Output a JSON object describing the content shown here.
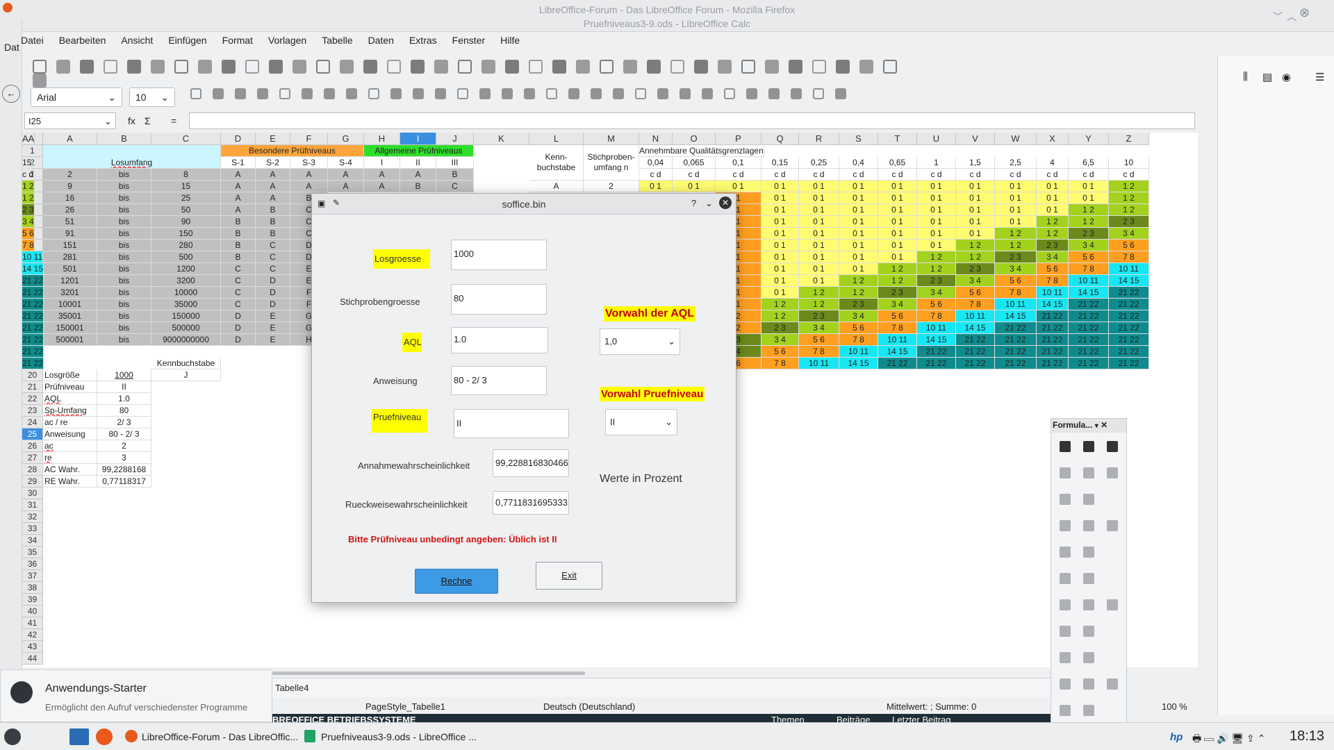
{
  "window": {
    "title_line1": "LibreOffice-Forum - Das LibreOffice Forum - Mozilla Firefox",
    "title_line2": "Pruefniveaus3-9.ods - LibreOffice Calc",
    "left_tab": "Dat"
  },
  "menu": [
    "Datei",
    "Bearbeiten",
    "Ansicht",
    "Einfügen",
    "Format",
    "Vorlagen",
    "Tabelle",
    "Daten",
    "Extras",
    "Fenster",
    "Hilfe"
  ],
  "toolbar": {
    "font": "Arial",
    "size": "10"
  },
  "formula_bar": {
    "name_box": "I25",
    "fx": "fx",
    "sigma": "Σ",
    "eq": "="
  },
  "columns": [
    "A",
    "B",
    "C",
    "D",
    "E",
    "F",
    "G",
    "H",
    "I",
    "J",
    "K",
    "L",
    "M",
    "N",
    "O",
    "P",
    "Q",
    "R",
    "S",
    "T",
    "U",
    "V",
    "W",
    "X",
    "Y",
    "Z",
    "AA"
  ],
  "rows": [
    "1",
    "2",
    "3",
    "4",
    "5",
    "6",
    "7",
    "8",
    "9",
    "10",
    "11",
    "12",
    "13",
    "14",
    "15",
    "16",
    "17",
    "18",
    "19",
    "20",
    "21",
    "22",
    "23",
    "24",
    "25",
    "26",
    "27",
    "28",
    "29",
    "30",
    "31",
    "32",
    "33",
    "34",
    "35",
    "36",
    "37",
    "38",
    "39",
    "40",
    "41",
    "42",
    "43",
    "44"
  ],
  "headers": {
    "losumfang": "Losumfang",
    "besondere": "Besondere Prüfniveaus",
    "allgemeine": "Allgemeine Prüfniveaus",
    "s_levels": [
      "S-1",
      "S-2",
      "S-3",
      "S-4"
    ],
    "g_levels": [
      "I",
      "II",
      "III"
    ],
    "kenn": "Kenn-\nbuchstabe",
    "stich": "Stichproben-\numfang n",
    "annehmbare": "Annehmbare Qualitätsgrenzlagen",
    "aql_values": [
      "0,04",
      "0,065",
      "0,1",
      "0,15",
      "0,25",
      "0,4",
      "0,65",
      "1",
      "1,5",
      "2,5",
      "4",
      "6,5",
      "10",
      "15"
    ],
    "cd": "c  d"
  },
  "lot_rows": [
    [
      "2",
      "bis",
      "8",
      "A",
      "A",
      "A",
      "A",
      "A",
      "A",
      "B"
    ],
    [
      "9",
      "bis",
      "15",
      "A",
      "A",
      "A",
      "A",
      "A",
      "B",
      "C"
    ],
    [
      "16",
      "bis",
      "25",
      "A",
      "A",
      "B",
      "",
      "",
      "",
      ""
    ],
    [
      "26",
      "bis",
      "50",
      "A",
      "B",
      "C",
      "",
      "",
      "",
      ""
    ],
    [
      "51",
      "bis",
      "90",
      "B",
      "B",
      "C",
      "",
      "",
      "",
      ""
    ],
    [
      "91",
      "bis",
      "150",
      "B",
      "B",
      "C",
      "",
      "",
      "",
      ""
    ],
    [
      "151",
      "bis",
      "280",
      "B",
      "C",
      "D",
      "",
      "",
      "",
      ""
    ],
    [
      "281",
      "bis",
      "500",
      "B",
      "C",
      "D",
      "",
      "",
      "",
      ""
    ],
    [
      "501",
      "bis",
      "1200",
      "C",
      "C",
      "E",
      "",
      "",
      "",
      ""
    ],
    [
      "1201",
      "bis",
      "3200",
      "C",
      "D",
      "E",
      "",
      "",
      "",
      ""
    ],
    [
      "3201",
      "bis",
      "10000",
      "C",
      "D",
      "F",
      "",
      "",
      "",
      ""
    ],
    [
      "10001",
      "bis",
      "35000",
      "C",
      "D",
      "F",
      "",
      "",
      "",
      ""
    ],
    [
      "35001",
      "bis",
      "150000",
      "D",
      "E",
      "G",
      "",
      "",
      "",
      ""
    ],
    [
      "150001",
      "bis",
      "500000",
      "D",
      "E",
      "G",
      "",
      "",
      "",
      ""
    ],
    [
      "500001",
      "bis",
      "9000000000",
      "D",
      "E",
      "H",
      "",
      "",
      "",
      ""
    ]
  ],
  "row4_LM": [
    "A",
    "2"
  ],
  "info": {
    "kenn_label": "Kennbuchstabe",
    "kenn_value": "J",
    "labels": [
      "Losgröße",
      "Prüfniveau",
      "AQL",
      "Sp-Umfang",
      "ac / re",
      "Anweisung",
      "ac",
      "re",
      "AC Wahr.",
      "RE Wahr."
    ],
    "values": [
      "1000",
      "II",
      "1.0",
      "80",
      "2/  3",
      "80 - 2/  3",
      "2",
      "3",
      "99,2288168",
      "0,77118317"
    ]
  },
  "aql_grid": [
    [
      "0 1",
      "0 1",
      "0 1",
      "0 1",
      "0 1",
      "0 1",
      "0 1",
      "0 1",
      "0 1",
      "0 1",
      "0 1",
      "0 1",
      "1 2",
      "1 2"
    ],
    [
      "",
      "",
      "1",
      "0 1",
      "0 1",
      "0 1",
      "0 1",
      "0 1",
      "0 1",
      "0 1",
      "0 1",
      "0 1",
      "1 2",
      "1 2"
    ],
    [
      "",
      "",
      "1",
      "0 1",
      "0 1",
      "0 1",
      "0 1",
      "0 1",
      "0 1",
      "0 1",
      "0 1",
      "1 2",
      "1 2",
      "2 3"
    ],
    [
      "",
      "",
      "1",
      "0 1",
      "0 1",
      "0 1",
      "0 1",
      "0 1",
      "0 1",
      "0 1",
      "1 2",
      "1 2",
      "2 3",
      "3 4"
    ],
    [
      "",
      "",
      "1",
      "0 1",
      "0 1",
      "0 1",
      "0 1",
      "0 1",
      "0 1",
      "1 2",
      "1 2",
      "2 3",
      "3 4",
      "5 6"
    ],
    [
      "",
      "",
      "1",
      "0 1",
      "0 1",
      "0 1",
      "0 1",
      "0 1",
      "1 2",
      "1 2",
      "2 3",
      "3 4",
      "5 6",
      "7 8"
    ],
    [
      "",
      "",
      "1",
      "0 1",
      "0 1",
      "0 1",
      "0 1",
      "1 2",
      "1 2",
      "2 3",
      "3 4",
      "5 6",
      "7 8",
      "10 11"
    ],
    [
      "",
      "",
      "1",
      "0 1",
      "0 1",
      "0 1",
      "1 2",
      "1 2",
      "2 3",
      "3 4",
      "5 6",
      "7 8",
      "10 11",
      "14 15"
    ],
    [
      "",
      "",
      "1",
      "0 1",
      "0 1",
      "1 2",
      "1 2",
      "2 3",
      "3 4",
      "5 6",
      "7 8",
      "10 11",
      "14 15",
      "21 22"
    ],
    [
      "",
      "",
      "1",
      "0 1",
      "1 2",
      "1 2",
      "2 3",
      "3 4",
      "5 6",
      "7 8",
      "10 11",
      "14 15",
      "21 22",
      "21 22"
    ],
    [
      "",
      "",
      "1",
      "1 2",
      "1 2",
      "2 3",
      "3 4",
      "5 6",
      "7 8",
      "10 11",
      "14 15",
      "21 22",
      "21 22",
      "21 22"
    ],
    [
      "",
      "",
      "2",
      "1 2",
      "2 3",
      "3 4",
      "5 6",
      "7 8",
      "10 11",
      "14 15",
      "21 22",
      "21 22",
      "21 22",
      "21 22"
    ],
    [
      "",
      "",
      "2",
      "2 3",
      "3 4",
      "5 6",
      "7 8",
      "10 11",
      "14 15",
      "21 22",
      "21 22",
      "21 22",
      "21 22",
      "21 22"
    ],
    [
      "",
      "",
      "3",
      "3 4",
      "5 6",
      "7 8",
      "10 11",
      "14 15",
      "21 22",
      "21 22",
      "21 22",
      "21 22",
      "21 22",
      "21 22"
    ],
    [
      "",
      "",
      "4",
      "5 6",
      "7 8",
      "10 11",
      "14 15",
      "21 22",
      "21 22",
      "21 22",
      "21 22",
      "21 22",
      "21 22",
      "21 22"
    ],
    [
      "",
      "",
      "6",
      "7 8",
      "10 11",
      "14 15",
      "21 22",
      "21 22",
      "21 22",
      "21 22",
      "21 22",
      "21 22",
      "21 22",
      "21 22"
    ]
  ],
  "colors": {
    "0 1": "#fffc72",
    "1 2": "#a3d21e",
    "2 3": "#6b8a1b",
    "3 4": "#a3d21e",
    "5 6": "#ff9f1f",
    "7 8": "#ff9f1f",
    "10 11": "#17e7f2",
    "14 15": "#17e7f2",
    "21 22": "#0e8c8d",
    "1": "#ff9f1f",
    "2": "#ff9f1f",
    "3": "#6b8a1b",
    "4": "#6b8a1b",
    "6": "#ff9f1f"
  },
  "dialog": {
    "title": "soffice.bin",
    "help": "?",
    "losgroesse_label": "Losgroesse",
    "losgroesse_value": "1000",
    "stich_label": "Stichprobengroesse",
    "stich_value": "80",
    "aql_label": "AQL",
    "aql_value": "1.0",
    "anweisung_label": "Anweisung",
    "anweisung_value": "80 - 2/  3",
    "pruef_label": "Pruefniveau",
    "pruef_value": "II",
    "vorwahl_aql": "Vorwahl der AQL",
    "vorwahl_aql_value": "1,0",
    "vorwahl_pruef": "Vorwahl Pruefniveau",
    "vorwahl_pruef_value": "II",
    "annahme_label": "Annahmewahrscheinlichkeit",
    "annahme_value": "99,2288168304668",
    "rueck_label": "Rueckweisewahrscheinlichkeit",
    "rueck_value": "0,771183169533316",
    "werte": "Werte in Prozent",
    "warning": "Bitte Prüfniveau unbedingt angeben: Üblich ist II",
    "rechne": "Rechne",
    "exit": "Exit"
  },
  "formula_panel": {
    "title": "Formula..."
  },
  "sheet_tab": "Tabelle4",
  "status": {
    "pagestyle": "PageStyle_Tabelle1",
    "language": "Deutsch (Deutschland)",
    "sum": "Mittelwert: ; Summe: 0",
    "zoom": "100 %"
  },
  "forum_bar": {
    "left": "BREOFFICE BETRIEBSSYSTEME",
    "themen": "Themen",
    "beitraege": "Beiträge",
    "letzter": "Letzter Beitrag"
  },
  "notification": {
    "title": "Anwendungs-Starter",
    "text": "Ermöglicht den Aufruf verschiedenster Programme"
  },
  "taskbar": {
    "item1": "LibreOffice-Forum - Das LibreOffic...",
    "item2": "Pruefniveaus3-9.ods - LibreOffice ...",
    "clock": "18:13"
  }
}
